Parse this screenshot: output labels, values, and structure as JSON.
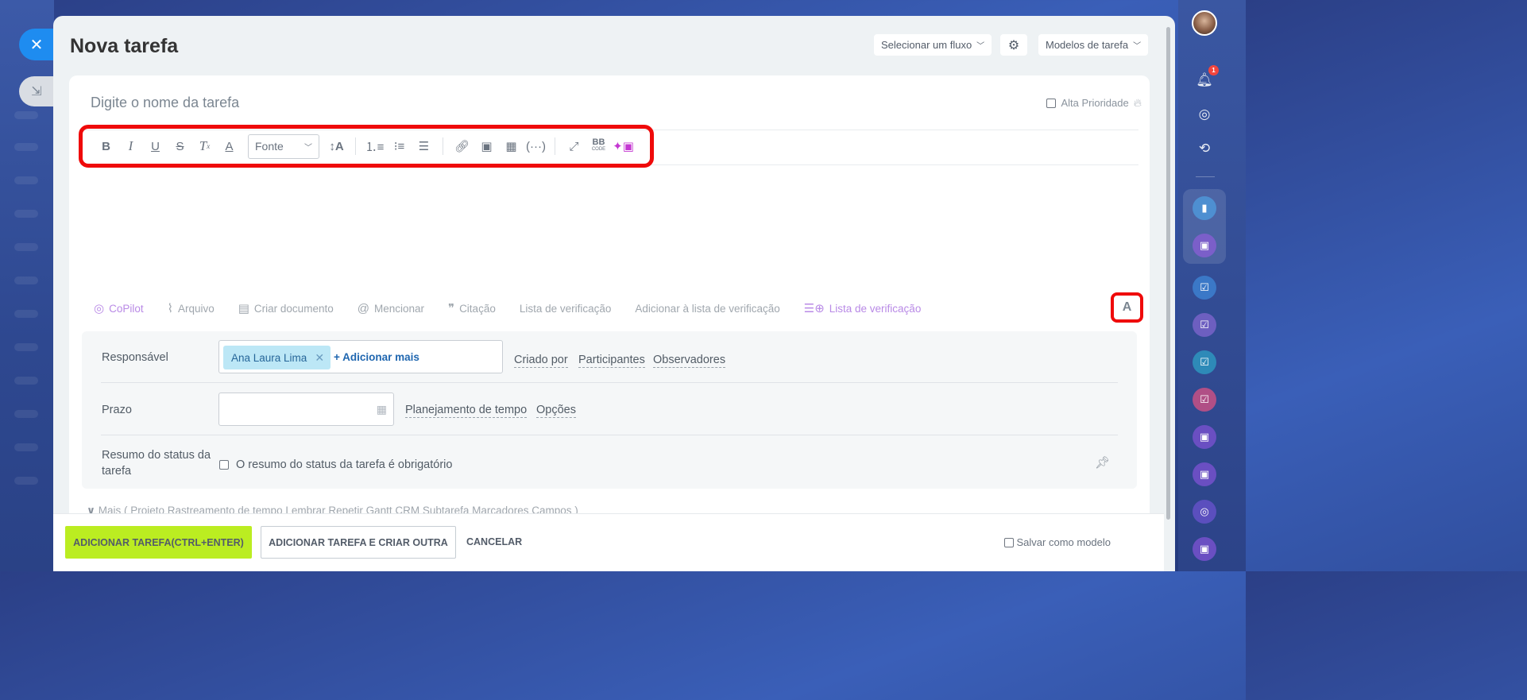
{
  "panel": {
    "title": "Nova tarefa",
    "flow_select": "Selecionar um fluxo",
    "templates_select": "Modelos de tarefa"
  },
  "form": {
    "task_name_placeholder": "Digite o nome da tarefa",
    "high_priority_label": "Alta Prioridade",
    "font_select": "Fonte",
    "bbcode_label": "BB",
    "bbcode_sub": "CODE",
    "a_button": "A"
  },
  "actions": [
    {
      "label": "CoPilot",
      "icon": "copilot-icon"
    },
    {
      "label": "Arquivo",
      "icon": "paperclip-icon"
    },
    {
      "label": "Criar documento",
      "icon": "document-icon"
    },
    {
      "label": "Mencionar",
      "icon": "at-icon"
    },
    {
      "label": "Citação",
      "icon": "quote-icon"
    },
    {
      "label": "Lista de verificação",
      "icon": ""
    },
    {
      "label": "Adicionar à lista de verificação",
      "icon": ""
    },
    {
      "label": "Lista de verificação",
      "icon": "checklist-add-icon"
    }
  ],
  "fields": {
    "responsible_label": "Responsável",
    "responsible_chip": "Ana Laura Lima",
    "add_more": "+ Adicionar mais",
    "created_by": "Criado por",
    "participants": "Participantes",
    "observers": "Observadores",
    "deadline_label": "Prazo",
    "deadline_value": "",
    "time_planning": "Planejamento de tempo",
    "options": "Opções",
    "status_summary_label_1": "Resumo do status da",
    "status_summary_label_2": "tarefa",
    "status_summary_checkbox": "O resumo do status da tarefa é obrigatório"
  },
  "more_line": "Mais  ( Projeto   Rastreamento de tempo   Lembrar   Repetir   Gantt   CRM   Subtarefa   Marcadores   Campos )",
  "footer": {
    "add_task": "ADICIONAR TAREFA(CTRL+ENTER)",
    "add_and_create": "ADICIONAR TAREFA E CRIAR OUTRA",
    "cancel": "CANCELAR",
    "save_template": "Salvar como modelo"
  },
  "sidebar": {
    "notification_count": "1"
  },
  "colors": {
    "primary_button": "#bbed21",
    "highlight_frame": "#ef0a0a",
    "chip_bg": "#bce7f6",
    "close_button": "#1e8cf0"
  }
}
